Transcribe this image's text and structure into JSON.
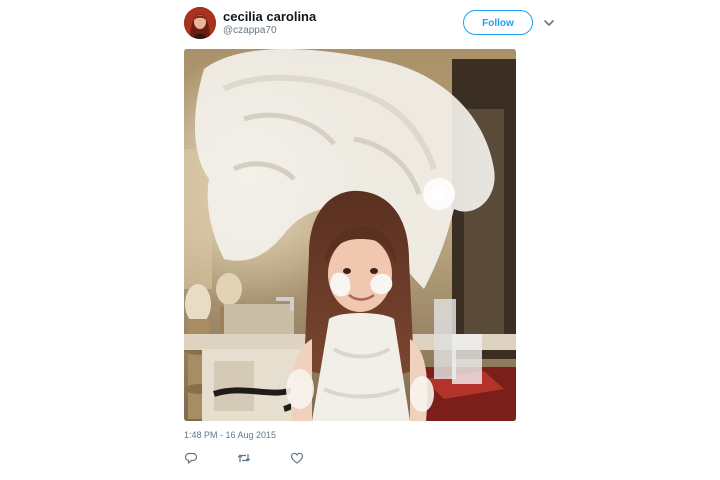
{
  "tweet": {
    "author": {
      "display_name": "cecilia carolina",
      "handle": "@czappa70"
    },
    "follow_label": "Follow",
    "timestamp": "1:48 PM - 16 Aug 2015"
  },
  "icons": {
    "menu": "chevron-down-icon",
    "reply": "reply-icon",
    "retweet": "retweet-icon",
    "like": "heart-icon"
  },
  "colors": {
    "accent": "#1da1f2",
    "text_primary": "#14171a",
    "text_secondary": "#657786"
  }
}
